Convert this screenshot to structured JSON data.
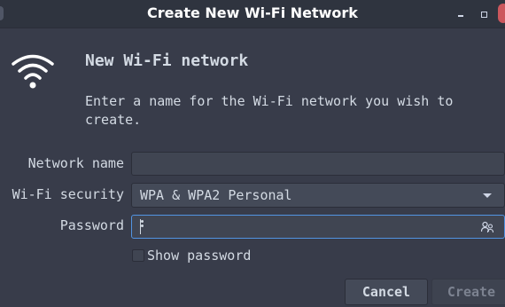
{
  "window": {
    "title": "Create New Wi-Fi Network"
  },
  "icons": {
    "main": "wifi-icon",
    "password_secondary": "keys-icon"
  },
  "heading": "New Wi-Fi network",
  "description": "Enter a name for the Wi-Fi network you wish to create.",
  "form": {
    "network_name": {
      "label": "Network name",
      "value": ""
    },
    "security": {
      "label": "Wi-Fi security",
      "value": "WPA & WPA2 Personal"
    },
    "password": {
      "label": "Password",
      "value": ""
    },
    "show_password": {
      "label": "Show password",
      "checked": false
    }
  },
  "buttons": {
    "cancel": "Cancel",
    "create": "Create"
  },
  "colors": {
    "accent": "#5294e2",
    "background": "#383c4a",
    "titlebar": "#2f343f",
    "close": "#cc575d"
  }
}
